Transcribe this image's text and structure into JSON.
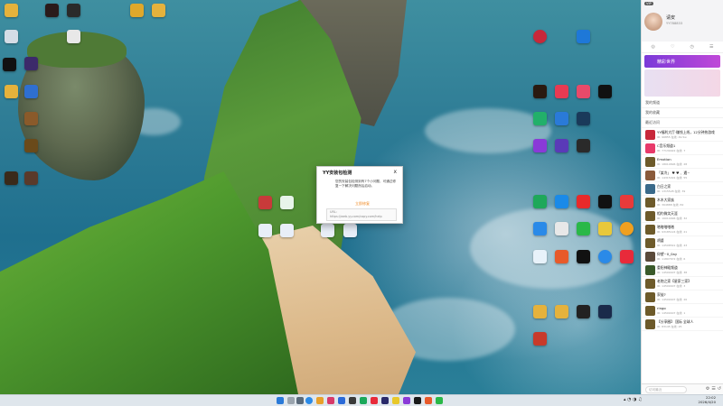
{
  "dialog": {
    "title": "YY安装包检测",
    "close": "x",
    "message": "您的安装包检测到有7个小问题，可通过修复一下解决问题然后启动。",
    "link": "立即修复",
    "url_label": "URL:",
    "url": "https://web.yy.com/copy.com/help"
  },
  "panel": {
    "name": "请安",
    "id": "YY788833",
    "badge": "VIP",
    "tabs": [
      "◎",
      "♡",
      "◷",
      "☰"
    ],
    "banner": "精彩世界",
    "sections": {
      "fav": "我的频道",
      "collect": "我的收藏",
      "recent": "最近访问"
    },
    "rows": [
      {
        "title": "YY福利大厅·赚钱上线，12分钟热游戏",
        "sub": "ID: 96855  在线: 49.5w"
      },
      {
        "title": "C音乐频道1",
        "sub": "ID: 77139922  在线: 7"
      },
      {
        "title": "Emotion",
        "sub": "ID: 18010696  在线: 28"
      },
      {
        "title": "「某冷」 ♥ ♥ 、遇~",
        "sub": "ID: 14315491  在线: 55"
      },
      {
        "title": "白日之家",
        "sub": "ID: 1315528  在线: 39"
      },
      {
        "title": "木木大家族",
        "sub": "ID: 364888  在线: 82"
      },
      {
        "title": "相约微笑天涯",
        "sub": "ID: 16010996  在线: 32"
      },
      {
        "title": "嗒嗒嗒嗒嗒",
        "sub": "ID: 93185124  在线: 21"
      },
      {
        "title": "胡婆",
        "sub": "ID: 14508541  在线: 43"
      },
      {
        "title": "仰望~0_0ay",
        "sub": "ID: 11807672  在线: 6"
      },
      {
        "title": "重阳神殿频道",
        "sub": "ID: 14509407  在线: 38"
      },
      {
        "title": "老炮之家【星家三家】",
        "sub": "ID: 14509407  在线: 3"
      },
      {
        "title": "家徒?",
        "sub": "ID: 14509407  在线: 26"
      },
      {
        "title": "ringo",
        "sub": "ID: 14509407  在线: 1"
      },
      {
        "title": "【分享圈】 国际 全球人",
        "sub": "ID: 83145  在线: 25"
      }
    ],
    "search_placeholder": "访问最近",
    "footer_icons": [
      "⚙",
      "☰",
      "↺"
    ]
  },
  "taskbar": {
    "time": "22:02",
    "date": "2026/4/20"
  },
  "colors": {
    "accent": "#f08a24",
    "yy_purple": "#7a3ad8",
    "taskbar": "#dfe6ec"
  }
}
